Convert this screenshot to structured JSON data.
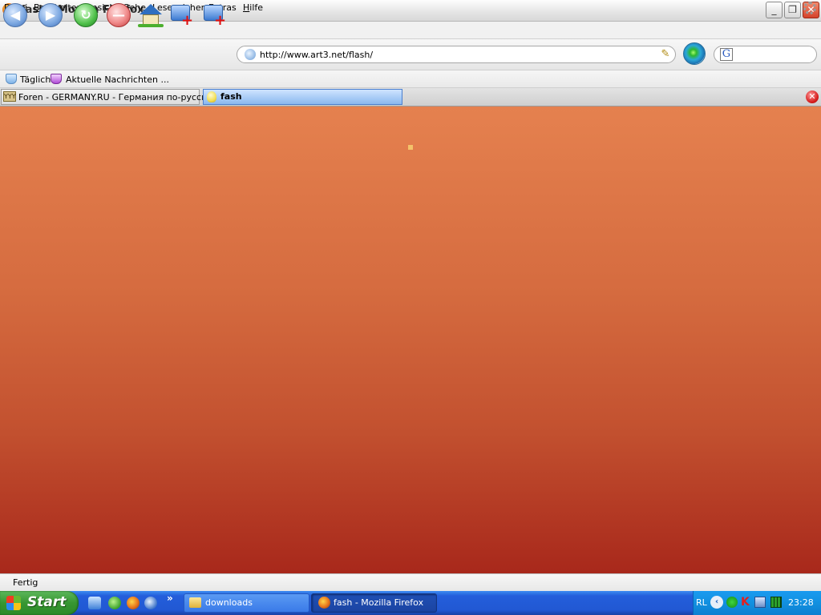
{
  "window": {
    "title": "fash - Mozilla Firefox",
    "minimize_glyph": "_",
    "maximize_glyph": "❐",
    "close_glyph": "✕"
  },
  "menu": [
    "Datei",
    "Bearbeiten",
    "Ansicht",
    "Gehe",
    "Lesezeichen",
    "Extras",
    "Hilfe"
  ],
  "nav": {
    "back_glyph": "◀",
    "forward_glyph": "▶",
    "reload_glyph": "↻",
    "stop_glyph": "—",
    "url": "http://www.art3.net/flash/",
    "url_dropmarker_glyph": "✎",
    "search_engine_glyph": "G"
  },
  "bookmarks": [
    "Täglich",
    "Aktuelle Nachrichten ..."
  ],
  "tabs": [
    {
      "label": "Foren - GERMANY.RU - Германия по-русски",
      "icon_glyph": "YYY",
      "selected": false
    },
    {
      "label": "fash",
      "selected": true
    }
  ],
  "tabbar": {
    "close_glyph": "✕"
  },
  "status": {
    "text": "Fertig"
  },
  "taskbar": {
    "start_label": "Start",
    "quicklaunch_more": "»",
    "tasks": [
      {
        "label": "downloads",
        "active": false
      },
      {
        "label": "fash - Mozilla Firefox",
        "active": true
      }
    ],
    "tray": {
      "language": "RL",
      "chevron_glyph": "‹",
      "icon_k": "K",
      "clock": "23:28"
    }
  },
  "colors": {
    "content_top": "#e5814f",
    "content_bottom": "#a8281b",
    "taskbar_blue": "#245edb",
    "start_green": "#379632"
  }
}
